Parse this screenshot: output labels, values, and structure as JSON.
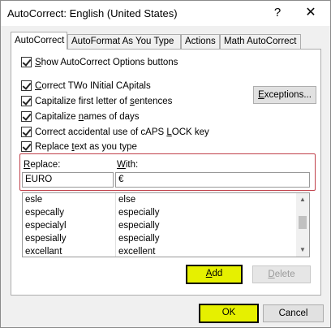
{
  "window": {
    "title": "AutoCorrect: English (United States)",
    "help_glyph": "?",
    "close_glyph": "✕"
  },
  "tabs": [
    {
      "label": "AutoCorrect",
      "active": true
    },
    {
      "label": "AutoFormat As You Type",
      "active": false
    },
    {
      "label": "Actions",
      "active": false
    },
    {
      "label": "Math AutoCorrect",
      "active": false
    }
  ],
  "options": {
    "show_buttons": {
      "pre": "",
      "key": "S",
      "post": "how AutoCorrect Options buttons",
      "checked": true
    },
    "two_initials": {
      "pre": "",
      "key": "C",
      "post": "orrect TWo INitial CApitals",
      "checked": true
    },
    "first_letter": {
      "pre": "Capitalize first letter of ",
      "key": "s",
      "post": "entences",
      "checked": true
    },
    "days": {
      "pre": "Capitalize ",
      "key": "n",
      "post": "ames of days",
      "checked": true
    },
    "caps_lock": {
      "pre": "Correct accidental use of cAPS ",
      "key": "L",
      "post": "OCK key",
      "checked": true
    },
    "replace_text": {
      "pre": "Replace ",
      "key": "t",
      "post": "ext as you type",
      "checked": true
    }
  },
  "buttons": {
    "exceptions": {
      "key": "E",
      "post": "xceptions..."
    },
    "add": {
      "key": "A",
      "post": "dd"
    },
    "delete": {
      "key": "D",
      "post": "elete"
    },
    "ok": "OK",
    "cancel": "Cancel"
  },
  "replace": {
    "replace_label": {
      "key": "R",
      "post": "eplace:"
    },
    "with_label": {
      "key": "W",
      "post": "ith:"
    },
    "replace_value": "EURO",
    "with_value": "€"
  },
  "entries": [
    {
      "replace": "esle",
      "with": "else"
    },
    {
      "replace": "especally",
      "with": "especially"
    },
    {
      "replace": "especialyl",
      "with": "especially"
    },
    {
      "replace": "espesially",
      "with": "especially"
    },
    {
      "replace": "excellant",
      "with": "excellent"
    }
  ],
  "highlight_color": "#e6f000",
  "scroll": {
    "up": "▲",
    "down": "▼"
  }
}
